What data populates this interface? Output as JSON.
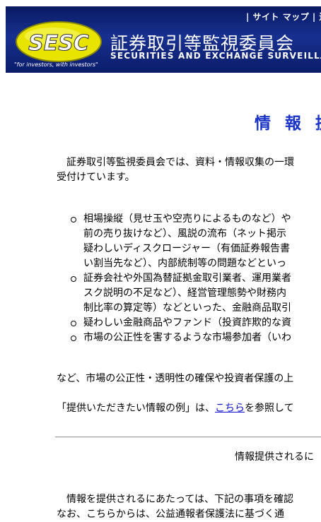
{
  "header": {
    "links_label": "| サイト マップ | 連絡",
    "tagline": "\"for investors, with investors\"",
    "org_name_jp": "証券取引等監視委員会",
    "org_name_en": "SECURITIES AND EXCHANGE SURVEILLANCE COI",
    "logo_text": "SESC"
  },
  "page": {
    "title": "情 報 提",
    "intro_line1": "　証券取引等監視委員会では、資料・情報収集の一環",
    "intro_line2": "受付けています。",
    "list": [
      [
        "相場操縦（見せ玉や空売りによるものなど）や",
        "前の売り抜けなど）、風説の流布（ネット掲示",
        "疑わしいディスクロージャー（有価証券報告書",
        "い割当先など）、内部統制等の問題などといっ"
      ],
      [
        "証券会社や外国為替証拠金取引業者、運用業者",
        "スク説明の不足など）、経営管理態勢や財務内",
        "制比率の算定等）などといった、金融商品取引"
      ],
      [
        "疑わしい金融商品やファンド（投資詐欺的な資"
      ],
      [
        "市場の公正性を害するような市場参加者（いわ"
      ]
    ],
    "closing_line": "など、市場の公正性・透明性の確保や投資者保護の上",
    "examples_prefix": "「提供いただきたい情報の例」は、",
    "examples_link": "こちら",
    "examples_suffix": "を参照して",
    "notice_heading": "情報提供されるに",
    "note_line1": "　情報を提供されるにあたっては、下記の事項を確認",
    "note_line2": "なお、こちらからは、公益通報者保護法に基づく通"
  }
}
